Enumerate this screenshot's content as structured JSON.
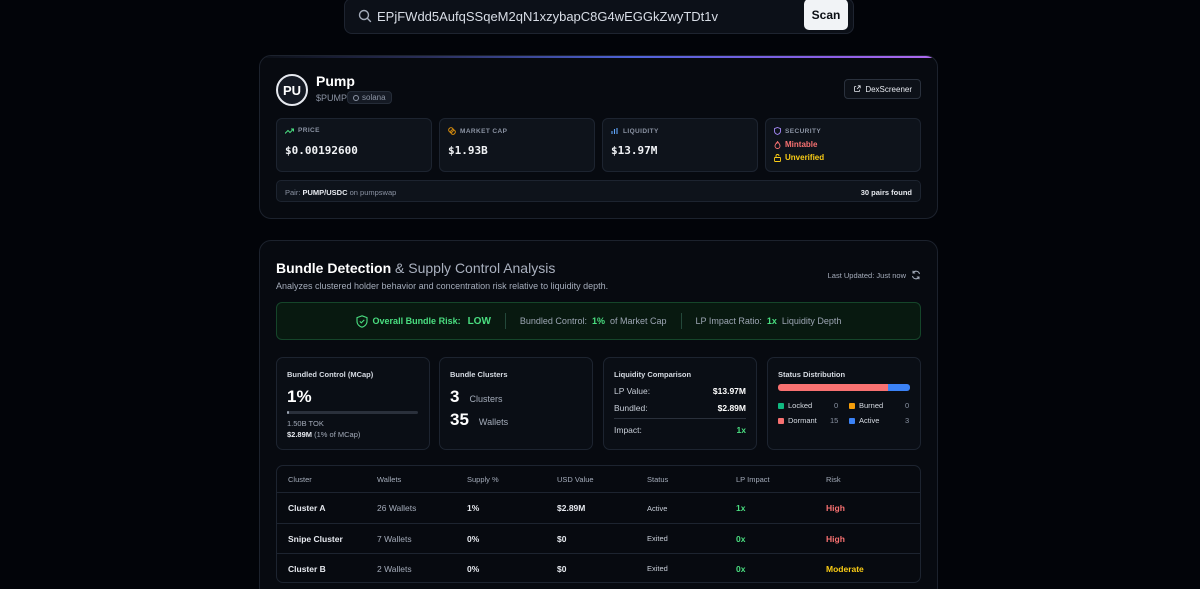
{
  "search": {
    "value": "EPjFWdd5AufqSSqeM2qN1xzybapC8G4wEGGkZwyTDt1v",
    "button": "Scan"
  },
  "token": {
    "avatar": "PU",
    "name": "Pump",
    "symbol": "$PUMP",
    "chain": "solana",
    "dex_button": "DexScreener",
    "stats": {
      "price_label": "PRICE",
      "price": "$0.00192600",
      "mcap_label": "MARKET CAP",
      "mcap": "$1.93B",
      "liq_label": "LIQUIDITY",
      "liq": "$13.97M",
      "sec_label": "SECURITY",
      "mintable": "Mintable",
      "unverified": "Unverified"
    },
    "pair": {
      "prefix": "Pair:",
      "pair": "PUMP/USDC",
      "on": "on pumpswap",
      "found": "30 pairs found"
    }
  },
  "bundle": {
    "title_bold": "Bundle Detection",
    "title_rest": "& Supply Control Analysis",
    "subtitle": "Analyzes clustered holder behavior and concentration risk relative to liquidity depth.",
    "last_updated": "Last Updated: Just now",
    "banner": {
      "risk_label": "Overall Bundle Risk:",
      "risk_value": "LOW",
      "control_label": "Bundled Control:",
      "control_value": "1%",
      "control_suffix": "of Market Cap",
      "lp_label": "LP Impact Ratio:",
      "lp_value": "1x",
      "lp_suffix": "Liquidity Depth"
    },
    "control_panel": {
      "title": "Bundled Control (MCap)",
      "value": "1%",
      "progress": 0.01,
      "tokens": "1.50B TOK",
      "usd": "$2.89M",
      "usd_note": "(1% of MCap)"
    },
    "clusters_panel": {
      "title": "Bundle Clusters",
      "clusters": "3",
      "clusters_label": "Clusters",
      "wallets": "35",
      "wallets_label": "Wallets"
    },
    "liquidity_panel": {
      "title": "Liquidity Comparison",
      "lp_label": "LP Value:",
      "lp_value": "$13.97M",
      "bundled_label": "Bundled:",
      "bundled_value": "$2.89M",
      "impact_label": "Impact:",
      "impact_value": "1x"
    },
    "status_panel": {
      "title": "Status Distribution",
      "items": [
        {
          "label": "Locked",
          "count": "0",
          "color": "#10b981"
        },
        {
          "label": "Burned",
          "count": "0",
          "color": "#f59e0b"
        },
        {
          "label": "Dormant",
          "count": "15",
          "color": "#f87171"
        },
        {
          "label": "Active",
          "count": "3",
          "color": "#3b82f6"
        }
      ]
    },
    "table": {
      "headers": [
        "Cluster",
        "Wallets",
        "Supply %",
        "USD Value",
        "Status",
        "LP Impact",
        "Risk"
      ],
      "rows": [
        {
          "cluster": "Cluster A",
          "wallets": "26 Wallets",
          "supply": "1%",
          "usd": "$2.89M",
          "status": "Active",
          "lp": "1x",
          "risk": "High"
        },
        {
          "cluster": "Snipe Cluster",
          "wallets": "7 Wallets",
          "supply": "0%",
          "usd": "$0",
          "status": "Exited",
          "lp": "0x",
          "risk": "High"
        },
        {
          "cluster": "Cluster B",
          "wallets": "2 Wallets",
          "supply": "0%",
          "usd": "$0",
          "status": "Exited",
          "lp": "0x",
          "risk": "Moderate"
        }
      ]
    }
  }
}
